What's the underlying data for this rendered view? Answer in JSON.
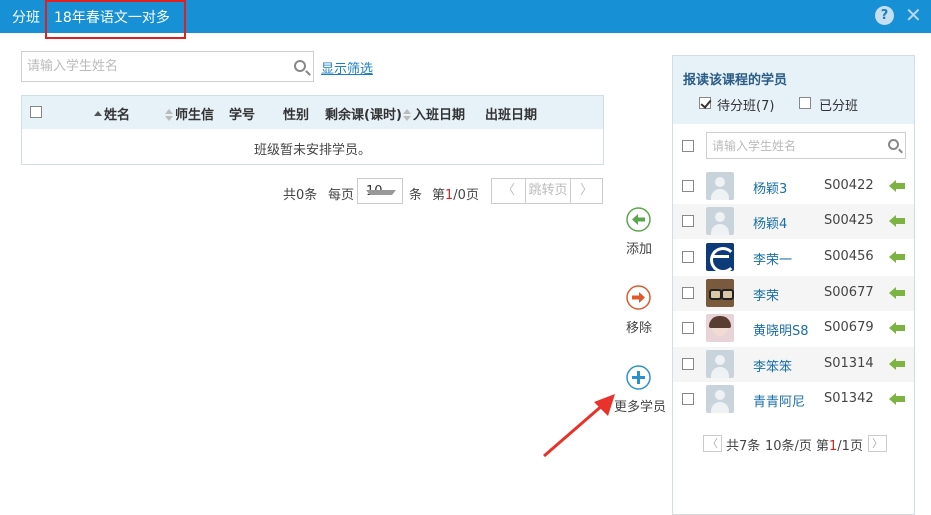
{
  "header": {
    "title": "分班",
    "class_name": "18年春语文一对多",
    "help_symbol": "?",
    "close_symbol": "✕",
    "bg_color": "#1890d5"
  },
  "left": {
    "search_placeholder": "请输入学生姓名",
    "filter_link": "显示筛选",
    "table": {
      "columns": [
        "姓名",
        "师生信",
        "学号",
        "性别",
        "剩余课(课时)",
        "入班日期",
        "出班日期"
      ],
      "empty_text": "班级暂未安排学员。"
    },
    "pager": {
      "total_text": "共0条",
      "per_page_label": "每页",
      "per_page_value": "10",
      "unit": "条",
      "page_prefix": "第",
      "page_current": "1",
      "page_suffix": "/0页",
      "jump_label": "跳转页",
      "prev_symbol": "〈",
      "next_symbol": "〉"
    }
  },
  "actions": {
    "add_label": "添加",
    "remove_label": "移除",
    "more_label": "更多学员",
    "add_color": "#5aa64a",
    "remove_color": "#e0582a",
    "more_color": "#2b8fd0"
  },
  "right": {
    "title": "报读该课程的学员",
    "tab_pending": "待分班(7)",
    "tab_assigned": "已分班",
    "search_placeholder": "请输入学生姓名",
    "students": [
      {
        "name": "杨颖3",
        "id": "S00422",
        "avatar": "default"
      },
      {
        "name": "杨颖4",
        "id": "S00425",
        "avatar": "default"
      },
      {
        "name": "李荣一",
        "id": "S00456",
        "avatar": "logo"
      },
      {
        "name": "李荣",
        "id": "S00677",
        "avatar": "glasses"
      },
      {
        "name": "黄晓明S8",
        "id": "S00679",
        "avatar": "photo"
      },
      {
        "name": "李笨笨",
        "id": "S01314",
        "avatar": "default"
      },
      {
        "name": "青青阿尼",
        "id": "S01342",
        "avatar": "default"
      }
    ],
    "pager": {
      "total_text": "共7条",
      "per_page_text": "10条/页",
      "page_prefix": "第",
      "page_current": "1",
      "page_suffix": "/1页",
      "prev_symbol": "〈",
      "next_symbol": "〉"
    }
  }
}
